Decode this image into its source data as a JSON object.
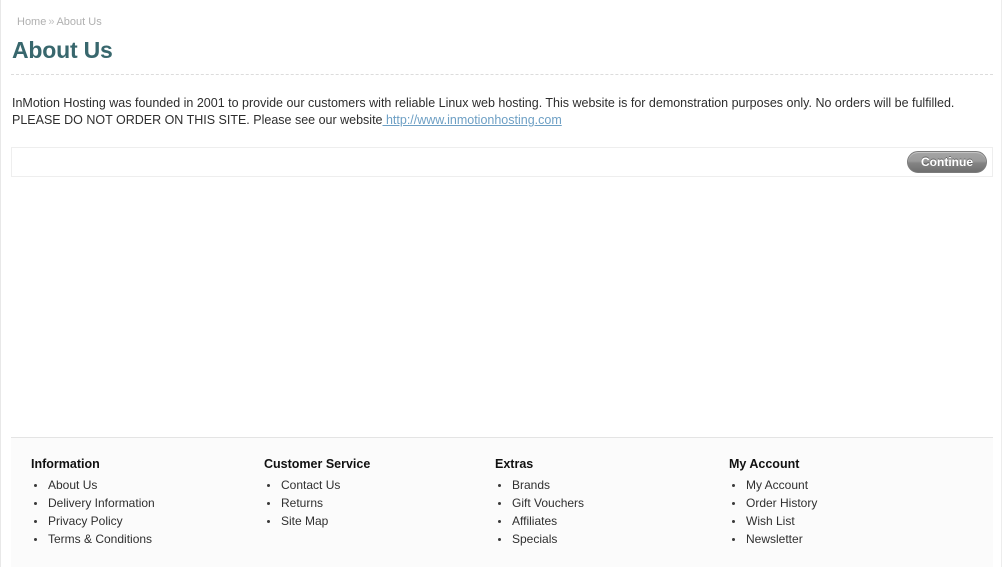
{
  "breadcrumb": {
    "items": [
      {
        "label": "Home"
      },
      {
        "label": "About Us"
      }
    ],
    "separator": "»"
  },
  "page": {
    "title": "About Us"
  },
  "content": {
    "paragraph_line1": "InMotion Hosting was founded in 2001 to provide our customers with reliable Linux web hosting. This website is for demonstration purposes only. No orders will be fulfilled.",
    "paragraph_line2_prefix": "PLEASE DO NOT ORDER ON THIS SITE. Please see our website",
    "link_text": " http://www.inmotionhosting.com"
  },
  "actions": {
    "continue_label": "Continue"
  },
  "footer": {
    "columns": [
      {
        "heading": "Information",
        "links": [
          {
            "label": "About Us"
          },
          {
            "label": "Delivery Information"
          },
          {
            "label": "Privacy Policy"
          },
          {
            "label": "Terms & Conditions"
          }
        ]
      },
      {
        "heading": "Customer Service",
        "links": [
          {
            "label": "Contact Us"
          },
          {
            "label": "Returns"
          },
          {
            "label": "Site Map"
          }
        ]
      },
      {
        "heading": "Extras",
        "links": [
          {
            "label": "Brands"
          },
          {
            "label": "Gift Vouchers"
          },
          {
            "label": "Affiliates"
          },
          {
            "label": "Specials"
          }
        ]
      },
      {
        "heading": "My Account",
        "links": [
          {
            "label": "My Account"
          },
          {
            "label": "Order History"
          },
          {
            "label": "Wish List"
          },
          {
            "label": "Newsletter"
          }
        ]
      }
    ]
  },
  "colors": {
    "heading_teal": "#38676d",
    "link_blue": "#6d9fc4",
    "breadcrumb_gray": "#b0b0b0",
    "footer_bg": "#fbfbfb"
  }
}
